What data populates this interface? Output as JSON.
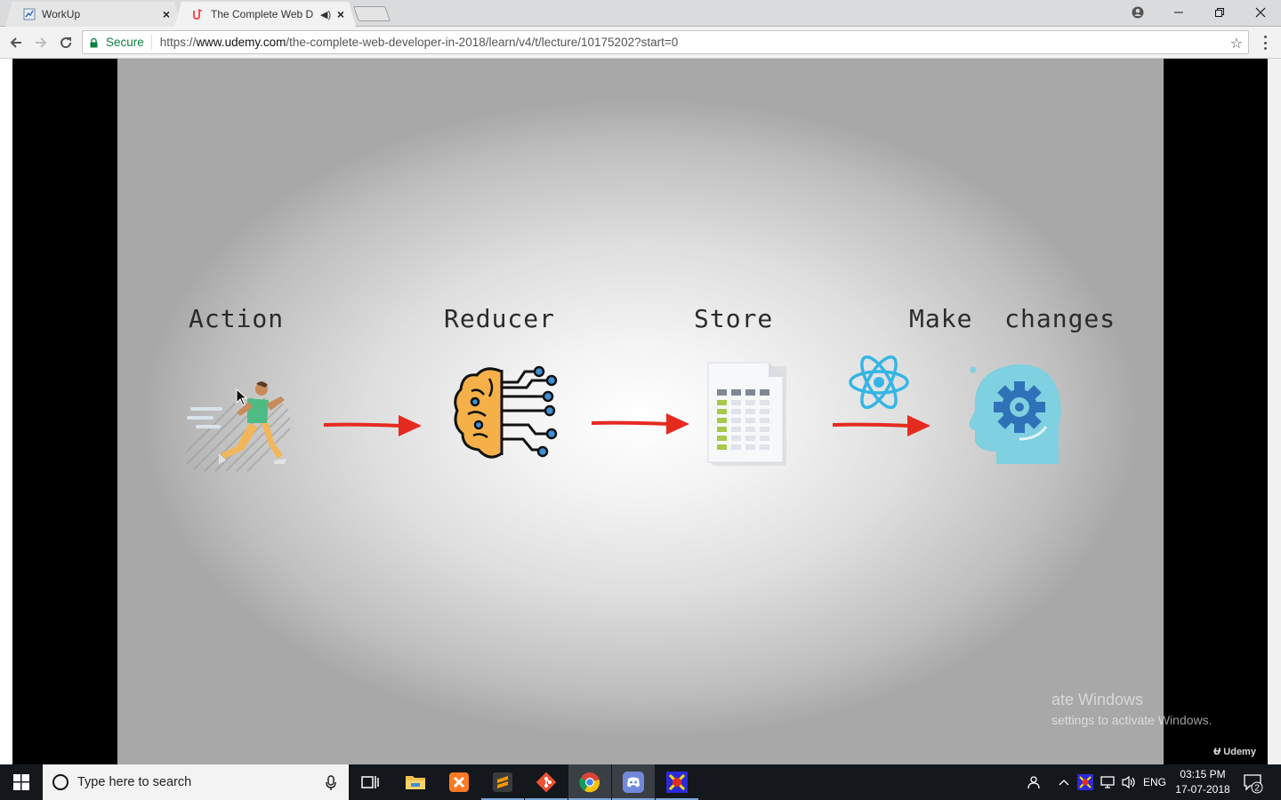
{
  "browser": {
    "tabs": [
      {
        "title": "WorkUp",
        "active": false
      },
      {
        "title": "The Complete Web D",
        "active": true,
        "playing_audio": true
      }
    ],
    "omnibox": {
      "secure_label": "Secure",
      "url_scheme": "https://",
      "url_host": "www.udemy.com",
      "url_path": "/the-complete-web-developer-in-2018/learn/v4/t/lecture/10175202?start=0"
    },
    "window_controls": [
      "profile-icon",
      "minimize-icon",
      "maximize-icon",
      "close-icon"
    ]
  },
  "slide": {
    "steps": [
      {
        "label": "Action",
        "icon": "running-person-icon"
      },
      {
        "label": "Reducer",
        "icon": "brain-circuit-icon"
      },
      {
        "label": "Store",
        "icon": "spreadsheet-document-icon"
      },
      {
        "label": "Make  changes",
        "icon": "head-gear-icon"
      }
    ],
    "connector": "red-arrow-icon",
    "extra_icon": "react-logo-icon",
    "colors": {
      "arrow": "#e52b20",
      "react": "#34b5e5",
      "gear_head": "#7fd0e0",
      "gear": "#2f72b8"
    }
  },
  "overlay": {
    "watermark_line1": "ate Windows",
    "watermark_line2": "settings to activate Windows.",
    "brand": "Udemy"
  },
  "taskbar": {
    "search_placeholder": "Type here to search",
    "apps": [
      "task-view-icon",
      "file-explorer-icon",
      "xampp-icon",
      "sublime-text-icon",
      "git-icon",
      "chrome-icon",
      "discord-icon",
      "app-icon"
    ],
    "language": "ENG",
    "time": "03:15 PM",
    "date": "17-07-2018",
    "notification_count": "2"
  }
}
